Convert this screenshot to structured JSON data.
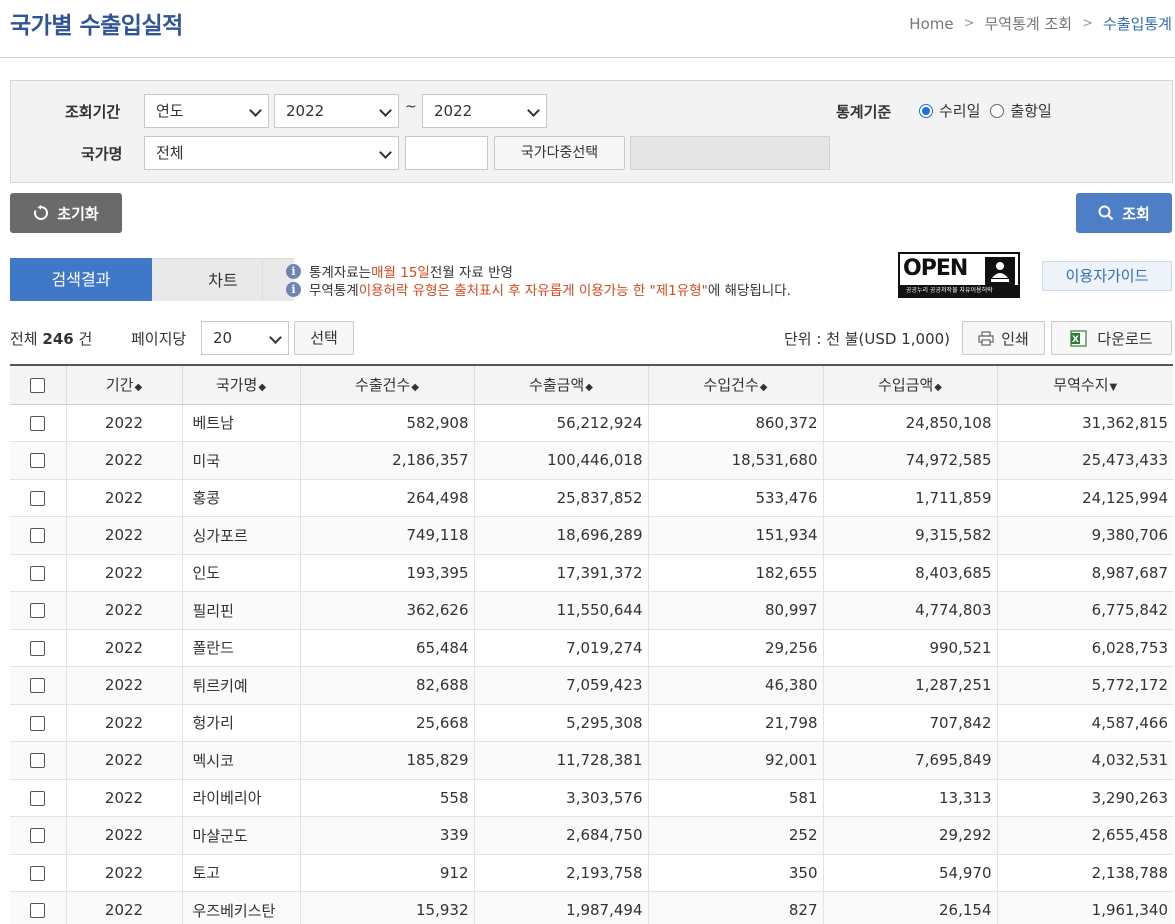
{
  "header": {
    "title": "국가별 수출입실적",
    "breadcrumb": [
      "Home",
      "무역통계 조회",
      "수출입통계"
    ]
  },
  "filters": {
    "period_label": "조회기간",
    "period_type": "연도",
    "period_from": "2022",
    "period_sep": "~",
    "period_to": "2022",
    "stat_basis_label": "통계기준",
    "stat_basis_options": [
      "수리일",
      "출항일"
    ],
    "stat_basis_selected": "수리일",
    "country_label": "국가명",
    "country_value": "전체",
    "country_text": "",
    "multi_select_button": "국가다중선택"
  },
  "actions": {
    "reset_label": "초기화",
    "search_label": "조회"
  },
  "tabs": [
    "검색결과",
    "차트"
  ],
  "notice": {
    "line1_a": "통계자료는 ",
    "line1_hl": "매월 15일",
    "line1_b": " 전월 자료 반영",
    "line2_a": "무역통계 ",
    "line2_hl": "이용허락 유형은 출처표시 후 자유롭게 이용가능 한 \"제1유형\"",
    "line2_b": "에 해당됩니다."
  },
  "open_license": {
    "word": "OPEN",
    "caption": "공공누리  공공저작물 자유이용허락"
  },
  "guide_button": "이용자가이드",
  "summary": {
    "total_prefix": "전체",
    "total_count": "246",
    "total_suffix": "건",
    "per_page_label": "페이지당",
    "per_page_value": "20",
    "select_button": "선택",
    "unit_text": "단위 : 천 불(USD 1,000)",
    "print_button": "인쇄",
    "download_button": "다운로드"
  },
  "table": {
    "columns": [
      "기간",
      "국가명",
      "수출건수",
      "수출금액",
      "수입건수",
      "수입금액",
      "무역수지"
    ],
    "sort_marks": [
      "◆",
      "◆",
      "◆",
      "◆",
      "◆",
      "◆",
      "▼"
    ],
    "rows": [
      [
        "2022",
        "베트남",
        "582,908",
        "56,212,924",
        "860,372",
        "24,850,108",
        "31,362,815"
      ],
      [
        "2022",
        "미국",
        "2,186,357",
        "100,446,018",
        "18,531,680",
        "74,972,585",
        "25,473,433"
      ],
      [
        "2022",
        "홍콩",
        "264,498",
        "25,837,852",
        "533,476",
        "1,711,859",
        "24,125,994"
      ],
      [
        "2022",
        "싱가포르",
        "749,118",
        "18,696,289",
        "151,934",
        "9,315,582",
        "9,380,706"
      ],
      [
        "2022",
        "인도",
        "193,395",
        "17,391,372",
        "182,655",
        "8,403,685",
        "8,987,687"
      ],
      [
        "2022",
        "필리핀",
        "362,626",
        "11,550,644",
        "80,997",
        "4,774,803",
        "6,775,842"
      ],
      [
        "2022",
        "폴란드",
        "65,484",
        "7,019,274",
        "29,256",
        "990,521",
        "6,028,753"
      ],
      [
        "2022",
        "튀르키예",
        "82,688",
        "7,059,423",
        "46,380",
        "1,287,251",
        "5,772,172"
      ],
      [
        "2022",
        "헝가리",
        "25,668",
        "5,295,308",
        "21,798",
        "707,842",
        "4,587,466"
      ],
      [
        "2022",
        "멕시코",
        "185,829",
        "11,728,381",
        "92,001",
        "7,695,849",
        "4,032,531"
      ],
      [
        "2022",
        "라이베리아",
        "558",
        "3,303,576",
        "581",
        "13,313",
        "3,290,263"
      ],
      [
        "2022",
        "마샬군도",
        "339",
        "2,684,750",
        "252",
        "29,292",
        "2,655,458"
      ],
      [
        "2022",
        "토고",
        "912",
        "2,193,758",
        "350",
        "54,970",
        "2,138,788"
      ],
      [
        "2022",
        "우즈베키스탄",
        "15,932",
        "1,987,494",
        "827",
        "26,154",
        "1,961,340"
      ]
    ]
  }
}
